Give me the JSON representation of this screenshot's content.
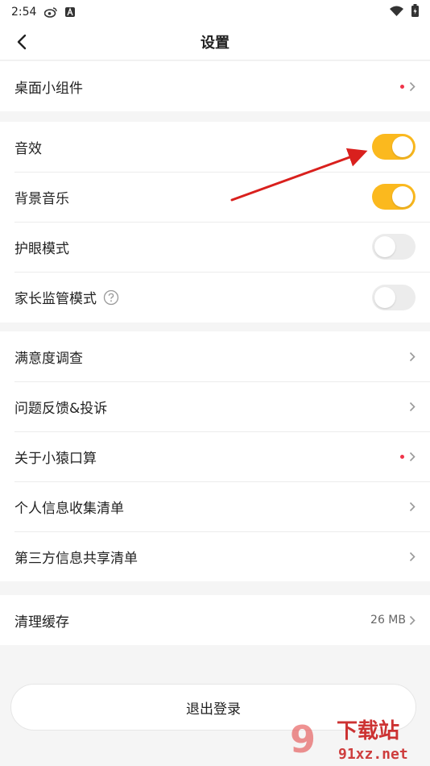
{
  "status_bar": {
    "time": "2:54"
  },
  "header": {
    "title": "设置"
  },
  "groups": {
    "widget": {
      "label": "桌面小组件",
      "has_dot": true
    },
    "sound_effects": {
      "label": "音效",
      "state": "on"
    },
    "background_music": {
      "label": "背景音乐",
      "state": "on"
    },
    "eye_protection": {
      "label": "护眼模式",
      "state": "off"
    },
    "parental_control": {
      "label": "家长监管模式",
      "state": "off"
    },
    "survey": {
      "label": "满意度调查"
    },
    "feedback": {
      "label": "问题反馈&投诉"
    },
    "about": {
      "label": "关于小猿口算",
      "has_dot": true
    },
    "personal_info": {
      "label": "个人信息收集清单"
    },
    "third_party": {
      "label": "第三方信息共享清单"
    },
    "clear_cache": {
      "label": "清理缓存",
      "value": "26 MB"
    }
  },
  "logout": {
    "label": "退出登录"
  },
  "watermark": {
    "brand": "下载站",
    "domain": "91xz.net"
  },
  "colors": {
    "toggle_on": "#fbb91e",
    "toggle_off": "#ececec",
    "dot": "#f0344a",
    "arrow": "#d9201d"
  }
}
